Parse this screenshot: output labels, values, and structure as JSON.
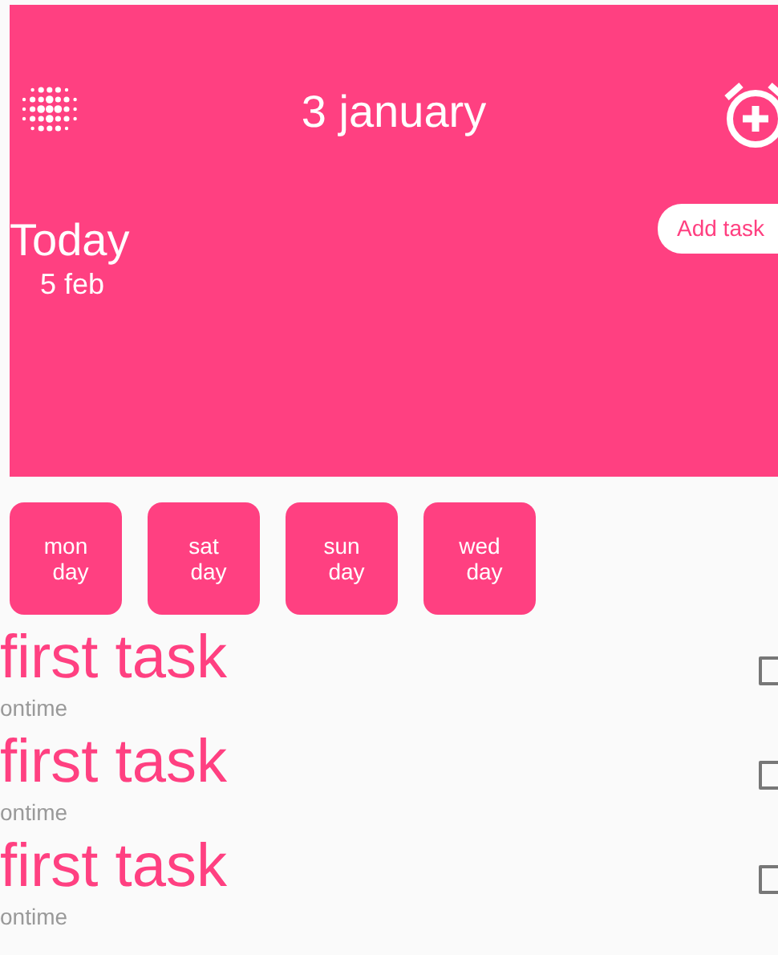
{
  "header": {
    "title": "3 january",
    "today_label": "Today",
    "today_date": "5 feb",
    "add_button": "Add task"
  },
  "days": [
    {
      "name": "mon",
      "sub": "day"
    },
    {
      "name": "sat",
      "sub": "day"
    },
    {
      "name": "sun",
      "sub": "day"
    },
    {
      "name": "wed",
      "sub": "day"
    }
  ],
  "tasks": [
    {
      "title": "first task",
      "status": "ontime",
      "checked": false
    },
    {
      "title": "first task",
      "status": "ontime",
      "checked": false
    },
    {
      "title": "first task",
      "status": "ontime",
      "checked": false
    }
  ]
}
